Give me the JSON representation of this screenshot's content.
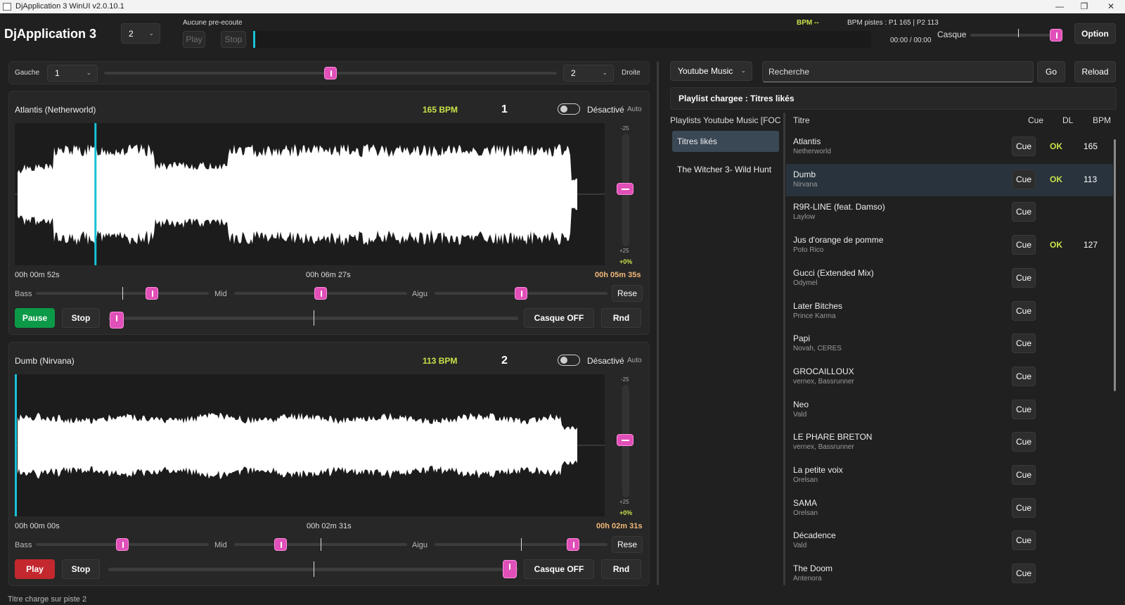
{
  "window": {
    "title": "DjApplication 3 WinUI v2.0.10.1",
    "min": "—",
    "max": "❐",
    "close": "✕"
  },
  "header": {
    "app_title": "DjApplication 3",
    "deck_select": "2",
    "preview_label": "Aucune pre-ecoute",
    "play": "Play",
    "stop": "Stop",
    "bpm_label": "BPM --",
    "bpm_pistes": "BPM pistes : P1 165 | P2 113",
    "time": "00:00 / 00:00",
    "casque": "Casque",
    "option": "Option"
  },
  "crossfader": {
    "left_label": "Gauche",
    "left_value": "1",
    "right_value": "2",
    "right_label": "Droite",
    "position": 0.5
  },
  "decks": [
    {
      "name": "Atlantis (Netherworld)",
      "bpm": "165 BPM",
      "number": "1",
      "toggle_label": "Désactivé",
      "auto": "Auto",
      "pitch_top": "-25",
      "pitch_bottom": "+25",
      "pitch_value": "+0%",
      "time_left": "00h 00m 52s",
      "time_mid": "00h 06m 27s",
      "time_right": "00h 05m 35s",
      "bass": "Bass",
      "mid": "Mid",
      "aigu": "Aigu",
      "reset": "Rese",
      "play_label": "Pause",
      "stop": "Stop",
      "casque": "Casque OFF",
      "rnd": "Rnd",
      "playhead": 0.135,
      "eq": [
        0.67,
        0.5,
        0.5
      ],
      "volume": 0.02
    },
    {
      "name": "Dumb (Nirvana)",
      "bpm": "113 BPM",
      "number": "2",
      "toggle_label": "Désactivé",
      "auto": "Auto",
      "pitch_top": "-25",
      "pitch_bottom": "+25",
      "pitch_value": "+0%",
      "time_left": "00h 00m 00s",
      "time_mid": "00h 02m 31s",
      "time_right": "00h 02m 31s",
      "bass": "Bass",
      "mid": "Mid",
      "aigu": "Aigu",
      "reset": "Rese",
      "play_label": "Play",
      "stop": "Stop",
      "casque": "Casque OFF",
      "rnd": "Rnd",
      "playhead": 0.0,
      "eq": [
        0.5,
        0.27,
        0.8
      ],
      "volume": 0.98
    }
  ],
  "right": {
    "source": "Youtube Music",
    "search_placeholder": "Recherche",
    "go": "Go",
    "reload": "Reload",
    "loaded_playlist": "Playlist chargee : Titres likés",
    "playlists_header": "Playlists Youtube Music [FOCL",
    "playlists": [
      "Titres likés",
      "The Witcher 3- Wild Hunt"
    ],
    "columns": {
      "title": "Titre",
      "cue": "Cue",
      "dl": "DL",
      "bpm": "BPM"
    },
    "tracks": [
      {
        "title": "Atlantis",
        "artist": "Netherworld",
        "cue": "Cue",
        "dl": "OK",
        "bpm": "165"
      },
      {
        "title": "Dumb",
        "artist": "Nirvana",
        "cue": "Cue",
        "dl": "OK",
        "bpm": "113"
      },
      {
        "title": "R9R-LINE (feat. Damso)",
        "artist": "Laylow",
        "cue": "Cue",
        "dl": "",
        "bpm": ""
      },
      {
        "title": "Jus d'orange de pomme",
        "artist": "Poto Rico",
        "cue": "Cue",
        "dl": "OK",
        "bpm": "127"
      },
      {
        "title": "Gucci (Extended Mix)",
        "artist": "Odymel",
        "cue": "Cue",
        "dl": "",
        "bpm": ""
      },
      {
        "title": "Later Bitches",
        "artist": "Prince Karma",
        "cue": "Cue",
        "dl": "",
        "bpm": ""
      },
      {
        "title": "Papi",
        "artist": "Novah, CERES",
        "cue": "Cue",
        "dl": "",
        "bpm": ""
      },
      {
        "title": "GROCAILLOUX",
        "artist": "vernex, Bassrunner",
        "cue": "Cue",
        "dl": "",
        "bpm": ""
      },
      {
        "title": "Neo",
        "artist": "Vald",
        "cue": "Cue",
        "dl": "",
        "bpm": ""
      },
      {
        "title": "LE PHARE BRETON",
        "artist": "vernex, Bassrunner",
        "cue": "Cue",
        "dl": "",
        "bpm": ""
      },
      {
        "title": "La petite voix",
        "artist": "Orelsan",
        "cue": "Cue",
        "dl": "",
        "bpm": ""
      },
      {
        "title": "SAMA",
        "artist": "Orelsan",
        "cue": "Cue",
        "dl": "",
        "bpm": ""
      },
      {
        "title": "Décadence",
        "artist": "Vald",
        "cue": "Cue",
        "dl": "",
        "bpm": ""
      },
      {
        "title": "The Doom",
        "artist": "Antenora",
        "cue": "Cue",
        "dl": "",
        "bpm": ""
      }
    ]
  },
  "status": "Titre charge sur piste 2"
}
